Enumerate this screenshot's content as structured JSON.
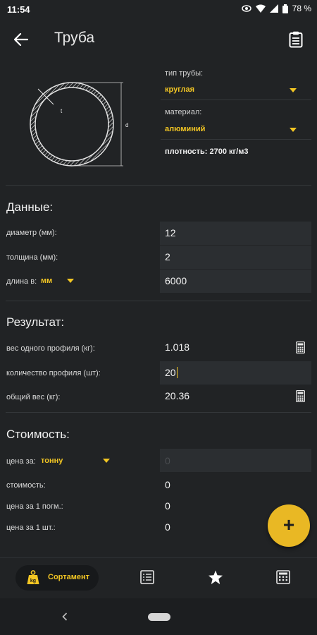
{
  "status": {
    "time": "11:54",
    "battery": "78 %"
  },
  "appbar": {
    "title": "Труба"
  },
  "diagram": {
    "thickness_label": "t",
    "diameter_label": "d"
  },
  "pipe_type": {
    "label": "тип трубы:",
    "value": "круглая"
  },
  "material": {
    "label": "материал:",
    "value": "алюминий"
  },
  "density": {
    "text": "плотность: 2700 кг/м3"
  },
  "data_section": {
    "title": "Данные:",
    "diameter_label": "диаметр (мм):",
    "diameter_value": "12",
    "thickness_label": "толщина (мм):",
    "thickness_value": "2",
    "length_label": "длина в:",
    "length_unit": "мм",
    "length_value": "6000"
  },
  "result_section": {
    "title": "Результат:",
    "weight_one_label": "вес одного профиля (кг):",
    "weight_one_value": "1.018",
    "count_label": "количество профиля (шт):",
    "count_value": "20",
    "total_label": "общий вес (кг):",
    "total_value": "20.36"
  },
  "cost_section": {
    "title": "Стоимость:",
    "price_per_label": "цена за:",
    "price_per_unit": "тонну",
    "price_placeholder": "0",
    "cost_label": "стоимость:",
    "cost_value": "0",
    "per_meter_label": "цена за 1 погм.:",
    "per_meter_value": "0",
    "per_piece_label": "цена за 1 шт.:",
    "per_piece_value": "0"
  },
  "fab": {
    "label": "+"
  },
  "bottom_nav": {
    "active_label": "Сортамент"
  },
  "colors": {
    "accent": "#f3c623",
    "background": "#212325",
    "field": "#2b2e31"
  }
}
